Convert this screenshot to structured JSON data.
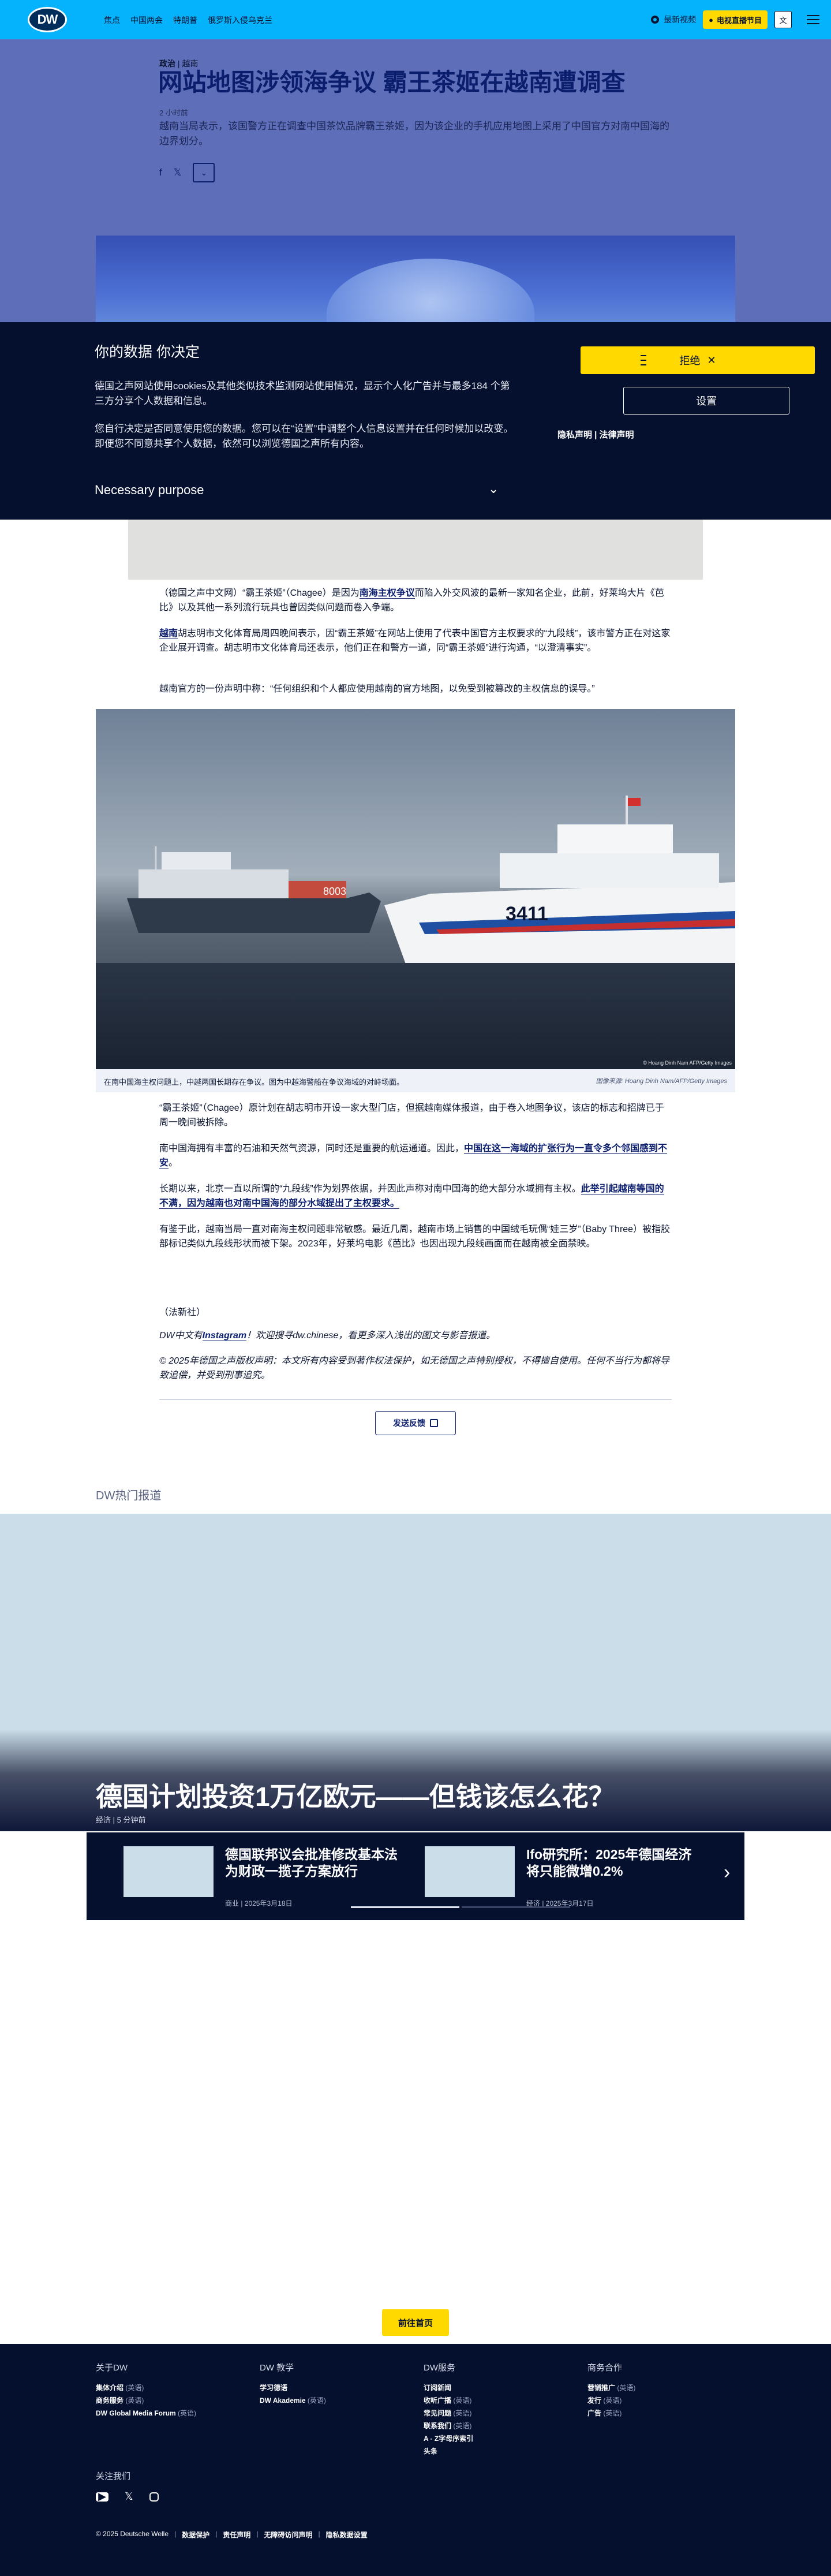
{
  "nav": {
    "logo": "DW",
    "links": [
      "焦点",
      "中国两会",
      "特朗普",
      "俄罗斯入侵乌克兰"
    ],
    "latest_video": "最新视频",
    "live_tv": "电视直播节目",
    "lang": "文"
  },
  "article": {
    "kicker_topic": "政治",
    "kicker_region": "越南",
    "title": "网站地图涉领海争议 霸王茶姬在越南遭调查",
    "time": "2 小时前",
    "teaser": "越南当局表示，该国警方正在调查中国茶饮品牌霸王茶姬，因为该企业的手机应用地图上采用了中国官方对南中国海的边界划分。",
    "share_icons": [
      "f",
      "𝕏",
      "⌄"
    ]
  },
  "cookie": {
    "title": "你的数据 你决定",
    "p1": "德国之声网站使用cookies及其他类似技术监测网站使用情况，显示个人化广告并与最多184 个第三方分享个人数据和信息。",
    "p2": "您自行决定是否同意使用您的数据。您可以在“设置”中调整个人信息设置并在任何时候加以改变。即便您不同意共享个人数据，依然可以浏览德国之声所有内容。",
    "purpose": "Necessary purpose",
    "reject": "拒绝",
    "settings": "设置",
    "links": "隐私声明 | 法律声明"
  },
  "body": {
    "p1_a": "（德国之声中文网）“霸王茶姬”（Chagee）是因为",
    "p1_link": "南海主权争议",
    "p1_b": "而陷入外交风波的最新一家知名企业，此前，好莱坞大片《芭比》以及其他一系列流行玩具也曾因类似问题而卷入争端。",
    "p2_link": "越南",
    "p2_b": "胡志明市文化体育局周四晚间表示，因“霸王茶姬”在网站上使用了代表中国官方主权要求的“九段线”，该市警方正在对这家企业展开调查。胡志明市文化体育局还表示，他们正在和警方一道，同“霸王茶姬”进行沟通，“以澄清事实”。",
    "p3": "越南官方的一份声明中称：“任何组织和个人都应使用越南的官方地图，以免受到被篡改的主权信息的误导。”",
    "photo_credit": "© Hoang Dinh Nam AFP/Getty Images",
    "caption": "在南中国海主权问题上，中越两国长期存在争议。图为中越海警船在争议海域的对峙场面。",
    "caption_credit": "图像来源: Hoang Dinh Nam/AFP/Getty Images",
    "p4": "“霸王茶姬”（Chagee）原计划在胡志明市开设一家大型门店，但据越南媒体报道，由于卷入地图争议，该店的标志和招牌已于周一晚间被拆除。",
    "p5_a": "南中国海拥有丰富的石油和天然气资源，同时还是重要的航运通道。因此，",
    "p5_link": "中国在这一海域的扩张行为一直令多个邻国感到不安",
    "p5_b": "。",
    "p6_a": "长期以来，北京一直以所谓的“九段线”作为划界依据，并因此声称对南中国海的绝大部分水域拥有主权。",
    "p6_link": "此举引起越南等国的不满，因为越南也对南中国海的部分水域提出了主权要求。",
    "p7": "有鉴于此，越南当局一直对南海主权问题非常敏感。最近几周，越南市场上销售的中国绒毛玩偶“娃三岁”（Baby Three）被指胶部标记类似九段线形状而被下架。2023年，好莱坞电影《芭比》也因出现九段线画面而在越南被全面禁映。",
    "agency": "（法新社）",
    "promo_a": "DW中文有",
    "promo_link": "Instagram",
    "promo_b": "！欢迎搜寻dw.chinese，看更多深入浅出的图文与影音报道。",
    "copyright": "© 2025年德国之声版权声明：本文所有内容受到著作权法保护，如无德国之声特别授权，不得擅自使用。任何不当行为都将导致追偿，并受到刑事追究。",
    "feedback": "发送反馈"
  },
  "hot": {
    "label": "DW热门报道",
    "title": "德国计划投资1万亿欧元——但钱该怎么花？",
    "meta": "经济 | 5 分钟前",
    "cards": [
      {
        "title": "德国联邦议会批准修改基本法为财政一揽子方案放行",
        "meta": "商业 | 2025年3月18日"
      },
      {
        "title": "Ifo研究所：2025年德国经济将只能微增0.2%",
        "meta": "经济 | 2025年3月17日"
      }
    ]
  },
  "back_home": "前往首页",
  "footer": {
    "cols": [
      {
        "title": "关于DW",
        "items": [
          {
            "t": "集体介绍",
            "l": "(英语)"
          },
          {
            "t": "商务服务",
            "l": "(英语)"
          },
          {
            "t": "DW Global Media Forum",
            "l": "(英语)"
          }
        ]
      },
      {
        "title": "DW 教学",
        "items": [
          {
            "t": "学习德语",
            "l": ""
          },
          {
            "t": "DW Akademie",
            "l": "(英语)"
          }
        ]
      },
      {
        "title": "DW服务",
        "items": [
          {
            "t": "订阅新闻",
            "l": ""
          },
          {
            "t": "收听广播",
            "l": "(英语)"
          },
          {
            "t": "常见问题",
            "l": "(英语)"
          },
          {
            "t": "联系我们",
            "l": "(英语)"
          },
          {
            "t": "A - Z字母序索引",
            "l": ""
          },
          {
            "t": "头条",
            "l": ""
          }
        ]
      },
      {
        "title": "商务合作",
        "items": [
          {
            "t": "营销推广",
            "l": "(英语)"
          },
          {
            "t": "发行",
            "l": "(英语)"
          },
          {
            "t": "广告",
            "l": "(英语)"
          }
        ]
      }
    ],
    "follow": "关注我们",
    "legal": [
      "© 2025 Deutsche Welle",
      "数据保护",
      "责任声明",
      "无障碍访问声明",
      "隐私数据设置"
    ]
  }
}
